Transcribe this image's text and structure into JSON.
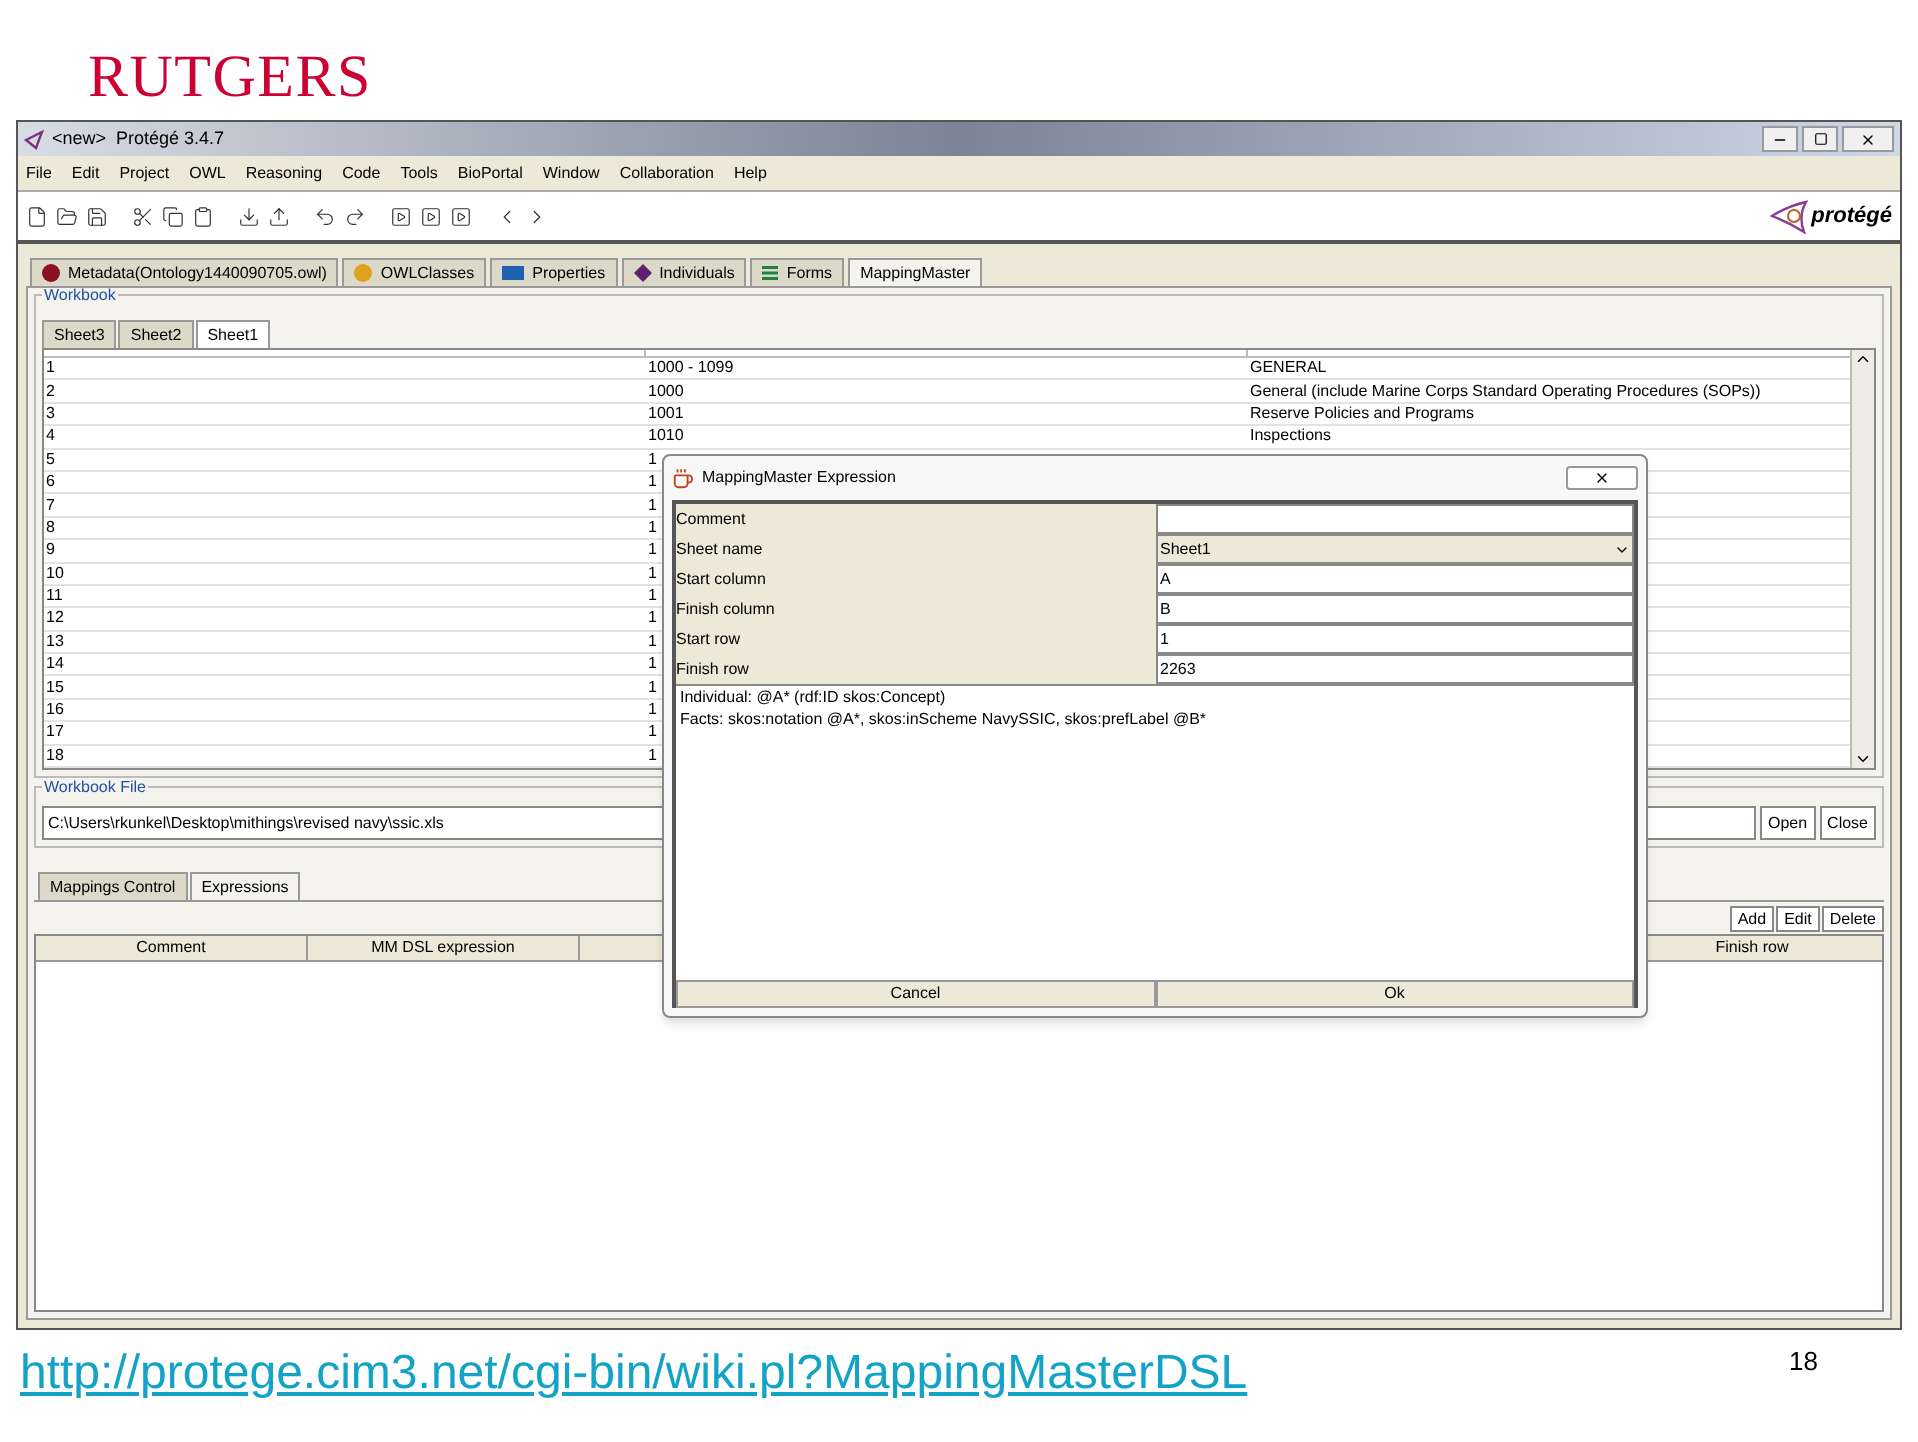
{
  "slide": {
    "logo": "RUTGERS",
    "link": "http://protege.cim3.net/cgi-bin/wiki.pl?MappingMasterDSL",
    "page_number": "18"
  },
  "window": {
    "title": "<new>  Protégé 3.4.7"
  },
  "menu": [
    "File",
    "Edit",
    "Project",
    "OWL",
    "Reasoning",
    "Code",
    "Tools",
    "BioPortal",
    "Window",
    "Collaboration",
    "Help"
  ],
  "brand": "protégé",
  "tabs": [
    {
      "label": "Metadata(Ontology1440090705.owl)",
      "selected": false,
      "kind": "circle",
      "color": "#8b1020"
    },
    {
      "label": "OWLClasses",
      "selected": false,
      "kind": "circle",
      "color": "#e0a020"
    },
    {
      "label": "Properties",
      "selected": false,
      "kind": "rect",
      "color": "#2060b0"
    },
    {
      "label": "Individuals",
      "selected": false,
      "kind": "diamond",
      "color": "#602070"
    },
    {
      "label": "Forms",
      "selected": false,
      "kind": "lines",
      "color": "#208040"
    },
    {
      "label": "MappingMaster",
      "selected": true,
      "kind": "none"
    }
  ],
  "workbook": {
    "title": "Workbook",
    "sheets": [
      {
        "label": "Sheet3",
        "selected": false
      },
      {
        "label": "Sheet2",
        "selected": false
      },
      {
        "label": "Sheet1",
        "selected": true
      }
    ],
    "rows": [
      [
        "1",
        "1000 - 1099",
        "GENERAL"
      ],
      [
        "2",
        "1000",
        "General (include Marine Corps Standard Operating Procedures (SOPs))"
      ],
      [
        "3",
        "1001",
        "Reserve Policies and Programs"
      ],
      [
        "4",
        "1010",
        "Inspections"
      ],
      [
        "5",
        "1"
      ],
      [
        "6",
        "1"
      ],
      [
        "7",
        "1"
      ],
      [
        "8",
        "1"
      ],
      [
        "9",
        "1"
      ],
      [
        "10",
        "1"
      ],
      [
        "11",
        "1"
      ],
      [
        "12",
        "1"
      ],
      [
        "13",
        "1"
      ],
      [
        "14",
        "1"
      ],
      [
        "15",
        "1"
      ],
      [
        "16",
        "1"
      ],
      [
        "17",
        "1"
      ],
      [
        "18",
        "1"
      ]
    ]
  },
  "workbook_file": {
    "title": "Workbook File",
    "path": "C:\\Users\\rkunkel\\Desktop\\mithings\\revised navy\\ssic.xls",
    "buttons": [
      "Open",
      "Close"
    ]
  },
  "lower_tabs": [
    {
      "label": "Mappings Control",
      "selected": false
    },
    {
      "label": "Expressions",
      "selected": true
    }
  ],
  "actions": [
    "Add",
    "Edit",
    "Delete"
  ],
  "columns": [
    "Comment",
    "MM DSL expression",
    "Finish row"
  ],
  "dialog": {
    "title": "MappingMaster Expression",
    "fields": [
      {
        "label": "Comment",
        "kind": "text"
      },
      {
        "label": "Sheet name",
        "value": "Sheet1",
        "kind": "select"
      },
      {
        "label": "Start column",
        "value": "A",
        "kind": "text"
      },
      {
        "label": "Finish column",
        "value": "B",
        "kind": "text"
      },
      {
        "label": "Start row",
        "value": "1",
        "kind": "text"
      },
      {
        "label": "Finish row",
        "value": "2263",
        "kind": "text"
      }
    ],
    "expression": [
      "Individual: @A* (rdf:ID skos:Concept)",
      "Facts: skos:notation @A*, skos:inScheme NavySSIC, skos:prefLabel @B*"
    ],
    "buttons": [
      "Cancel",
      "Ok"
    ]
  }
}
